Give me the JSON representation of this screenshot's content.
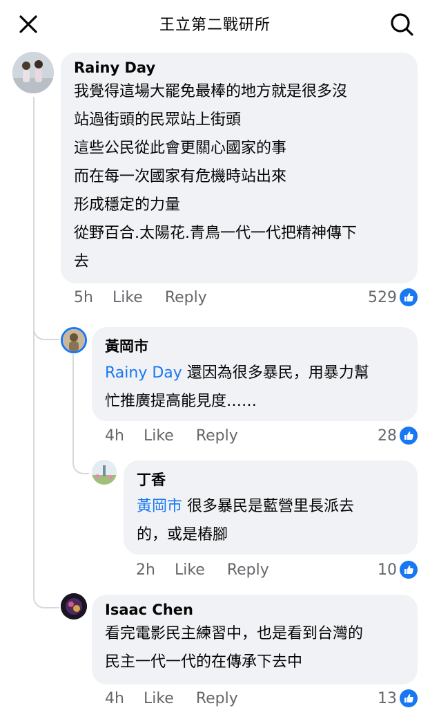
{
  "header": {
    "title": "王立第二戰研所"
  },
  "comments": [
    {
      "author": "Rainy Day",
      "lines": [
        "我覺得這場大罷免最棒的地方就是很多沒",
        "站過街頭的民眾站上街頭",
        "這些公民從此會更關心國家的事",
        "而在每一次國家有危機時站出來",
        "形成穩定的力量",
        "從野百合.太陽花.青鳥一代一代把精神傳下",
        "去"
      ],
      "time": "5h",
      "like": "Like",
      "reply": "Reply",
      "count": "529"
    },
    {
      "author": "黃岡市",
      "mention": "Rainy Day",
      "line1": "還因為很多暴民，用暴力幫",
      "line2": "忙推廣提高能見度……",
      "time": "4h",
      "like": "Like",
      "reply": "Reply",
      "count": "28"
    },
    {
      "author": "丁香",
      "mention": "黃岡市",
      "line1": "很多暴民是藍營里長派去",
      "line2": "的，或是樁腳",
      "time": "2h",
      "like": "Like",
      "reply": "Reply",
      "count": "10"
    },
    {
      "author": "Isaac Chen",
      "line1": "看完電影民主練習中，也是看到台灣的",
      "line2": "民主一代一代的在傳承下去中",
      "time": "4h",
      "like": "Like",
      "reply": "Reply",
      "count": "13"
    }
  ],
  "colors": {
    "accent": "#1877f2",
    "bubble": "#f0f2f5",
    "meta": "#65676b"
  },
  "icons": {
    "close": "close-icon",
    "search": "search-icon",
    "like": "thumbs-up-icon"
  }
}
